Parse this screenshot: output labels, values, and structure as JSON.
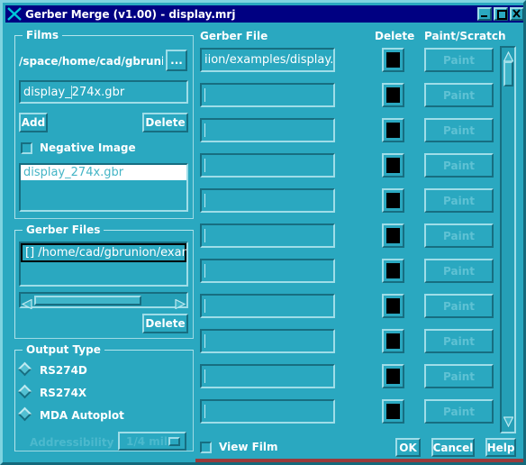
{
  "window": {
    "title": "Gerber Merge (v1.00) - display.mrj",
    "icon": "x-logo-icon",
    "buttons": {
      "minimize": "minimize-icon",
      "maximize": "maximize-icon",
      "close": "close-icon"
    }
  },
  "films": {
    "group_title": "Films",
    "path_label": "/space/home/cad/gbrunion/e",
    "browse_label": "...",
    "filename_value": "display_274x.gbr",
    "filename_caret_after": "display_",
    "filename_caret_rest": "274x.gbr",
    "add_label": "Add",
    "delete_label": "Delete",
    "negative_image_label": "Negative Image",
    "negative_image_checked": false,
    "list_items": [
      "display_274x.gbr"
    ]
  },
  "gerber_files": {
    "group_title": "Gerber Files",
    "list_items": [
      "[] /home/cad/gbrunion/example"
    ],
    "delete_label": "Delete"
  },
  "output_type": {
    "group_title": "Output Type",
    "options": [
      "RS274D",
      "RS274X",
      "MDA Autoplot"
    ],
    "addressibility_label": "Addressibility",
    "addressibility_value": "1/4 mil",
    "addressibility_disabled": true
  },
  "grid": {
    "headers": {
      "file": "Gerber File",
      "delete": "Delete",
      "paint": "Paint/Scratch"
    },
    "paint_label": "Paint",
    "rows": [
      {
        "file": "iion/examples/display.gbr",
        "empty": false
      },
      {
        "file": "",
        "empty": true
      },
      {
        "file": "",
        "empty": true
      },
      {
        "file": "",
        "empty": true
      },
      {
        "file": "",
        "empty": true
      },
      {
        "file": "",
        "empty": true
      },
      {
        "file": "",
        "empty": true
      },
      {
        "file": "",
        "empty": true
      },
      {
        "file": "",
        "empty": true
      },
      {
        "file": "",
        "empty": true
      },
      {
        "file": "",
        "empty": true
      }
    ]
  },
  "footer": {
    "view_film_label": "View Film",
    "view_film_checked": false,
    "ok_label": "OK",
    "cancel_label": "Cancel",
    "help_label": "Help"
  },
  "colors": {
    "background": "#2aa8c0",
    "titlebar": "#000082",
    "title_text": "#ffffff",
    "bevel_light": "#9fdde8",
    "bevel_dark": "#176e81",
    "disabled_text": "#5fc2d4",
    "delete_swatch": "#000000"
  }
}
